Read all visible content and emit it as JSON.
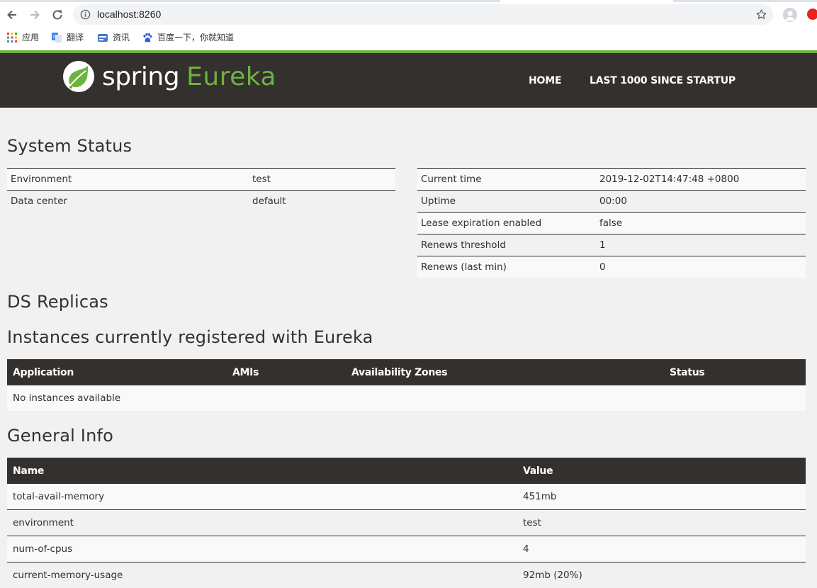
{
  "browser": {
    "url": "localhost:8260",
    "bookmarks": [
      {
        "label": "应用",
        "icon": "apps-grid-icon"
      },
      {
        "label": "翻译",
        "icon": "google-translate-icon"
      },
      {
        "label": "资讯",
        "icon": "news-icon"
      },
      {
        "label": "百度一下，你就知道",
        "icon": "baidu-paw-icon"
      }
    ]
  },
  "header": {
    "logo_spring": "spring",
    "logo_eureka": "Eureka",
    "nav": {
      "home": "HOME",
      "last1000": "LAST 1000 SINCE STARTUP"
    }
  },
  "system_status": {
    "title": "System Status",
    "left": [
      {
        "key": "Environment",
        "value": "test"
      },
      {
        "key": "Data center",
        "value": "default"
      }
    ],
    "right": [
      {
        "key": "Current time",
        "value": "2019-12-02T14:47:48 +0800"
      },
      {
        "key": "Uptime",
        "value": "00:00"
      },
      {
        "key": "Lease expiration enabled",
        "value": "false"
      },
      {
        "key": "Renews threshold",
        "value": "1"
      },
      {
        "key": "Renews (last min)",
        "value": "0"
      }
    ]
  },
  "ds_replicas": {
    "title": "DS Replicas"
  },
  "instances": {
    "title": "Instances currently registered with Eureka",
    "columns": [
      "Application",
      "AMIs",
      "Availability Zones",
      "Status"
    ],
    "empty_message": "No instances available"
  },
  "general_info": {
    "title": "General Info",
    "columns": [
      "Name",
      "Value"
    ],
    "rows": [
      {
        "name": "total-avail-memory",
        "value": "451mb"
      },
      {
        "name": "environment",
        "value": "test"
      },
      {
        "name": "num-of-cpus",
        "value": "4"
      },
      {
        "name": "current-memory-usage",
        "value": "92mb (20%)"
      }
    ]
  },
  "colors": {
    "brand_green": "#6db33f",
    "navbar_dark": "#34302d",
    "page_bg": "#f1f1f1"
  }
}
